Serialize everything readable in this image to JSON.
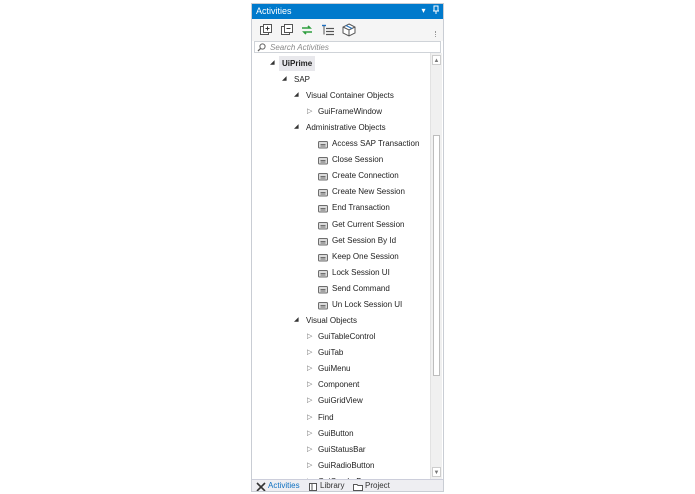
{
  "panel": {
    "title": "Activities",
    "title_buttons": [
      "▾",
      "❘"
    ]
  },
  "toolbar": {
    "buttons": [
      "expand-all-icon",
      "collapse-all-icon",
      "refresh-icon",
      "filter-icon",
      "package-icon"
    ]
  },
  "search": {
    "placeholder": "Search Activities"
  },
  "tree": {
    "root": "UiPrime",
    "sap": "SAP",
    "visual_container": "Visual Container Objects",
    "gui_frame_window": "GuiFrameWindow",
    "administrative": "Administrative Objects",
    "admin_items": [
      "Access SAP Transaction",
      "Close Session",
      "Create Connection",
      "Create New Session",
      "End Transaction",
      "Get Current Session",
      "Get Session By Id",
      "Keep One Session",
      "Lock Session UI",
      "Send Command",
      "Un Lock Session UI"
    ],
    "visual_objects": "Visual Objects",
    "visual_items": [
      "GuiTableControl",
      "GuiTab",
      "GuiMenu",
      "Component",
      "GuiGridView",
      "Find",
      "GuiButton",
      "GuiStatusBar",
      "GuiRadioButton",
      "GuiComboBox"
    ]
  },
  "bottom_tabs": {
    "activities": "Activities",
    "library": "Library",
    "project": "Project"
  },
  "colors": {
    "accent": "#007acc",
    "active_tab": "#0e70c0"
  }
}
